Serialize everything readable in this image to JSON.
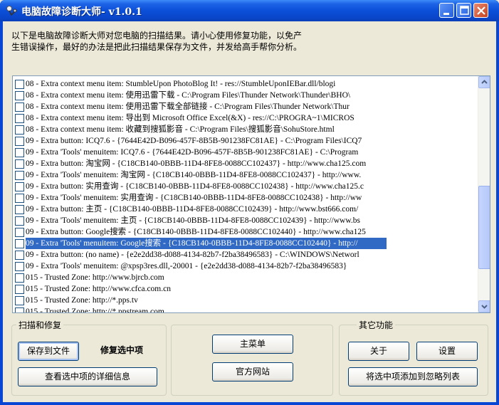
{
  "window": {
    "title": "电脑故障诊断大师- v1.0.1",
    "buttons": [
      "minimize",
      "maximize",
      "close"
    ]
  },
  "intro": {
    "line1": "以下是电脑故障诊断大师对您电脑的扫描结果。请小心使用修复功能，以免产",
    "line2": "生错误操作，最好的办法是把此扫描结果保存为文件，并发给高手帮你分析。"
  },
  "results": {
    "selected_index": 14,
    "items": [
      "08 - Extra context menu item: StumbleUpon PhotoBlog It! - res://StumbleUponIEBar.dll/blogi",
      "08 - Extra context menu item: 使用迅雷下载 - C:\\Program Files\\Thunder Network\\Thunder\\BHO\\",
      "08 - Extra context menu item: 使用迅雷下载全部链接 - C:\\Program Files\\Thunder Network\\Thur",
      "08 - Extra context menu item: 导出到 Microsoft Office Excel(&X) - res://C:\\PROGRA~1\\MICROS",
      "08 - Extra context menu item: 收藏到搜狐影音 - C:\\Program Files\\搜狐影音\\SohuStore.html",
      "09 - Extra button: ICQ7.6 - {7644E42D-B096-457F-8B5B-901238FC81AE} - C:\\Program Files\\ICQ7",
      "09 - Extra 'Tools' menuitem: ICQ7.6 - {7644E42D-B096-457F-8B5B-901238FC81AE} - C:\\Program",
      "09 - Extra button: 淘宝网 - {C18CB140-0BBB-11D4-8FE8-0088CC102437} - http://www.cha125.com",
      "09 - Extra 'Tools' menuitem: 淘宝网 - {C18CB140-0BBB-11D4-8FE8-0088CC102437} - http://www.",
      "09 - Extra button: 实用查询 - {C18CB140-0BBB-11D4-8FE8-0088CC102438} - http://www.cha125.c",
      "09 - Extra 'Tools' menuitem: 实用查询 - {C18CB140-0BBB-11D4-8FE8-0088CC102438} - http://ww",
      "09 - Extra button: 主页 - {C18CB140-0BBB-11D4-8FE8-0088CC102439} - http://www.bst666.com/",
      "09 - Extra 'Tools' menuitem: 主页 - {C18CB140-0BBB-11D4-8FE8-0088CC102439} - http://www.bs",
      "09 - Extra button: Google搜索 - {C18CB140-0BBB-11D4-8FE8-0088CC102440} - http://www.cha125",
      "09 - Extra 'Tools' menuitem: Google搜索 - {C18CB140-0BBB-11D4-8FE8-0088CC102440} - http://",
      "09 - Extra button: (no name) - {e2e2dd38-d088-4134-82b7-f2ba38496583} - C:\\WINDOWS\\Networl",
      "09 - Extra 'Tools' menuitem: @xpsp3res.dll,-20001 - {e2e2dd38-d088-4134-82b7-f2ba38496583}",
      "015 - Trusted Zone: http://www.bjrcb.com",
      "015 - Trusted Zone: http://www.cfca.com.cn",
      "015 - Trusted Zone: http://*.pps.tv",
      "015 - Trusted Zone: http://*.ppstream.com"
    ]
  },
  "groups": {
    "scan": {
      "label": "扫描和修复",
      "save_label": "保存到文件",
      "fix_label": "修复选中项",
      "details_label": "查看选中项的详细信息"
    },
    "middle": {
      "main_menu_label": "主菜单",
      "website_label": "官方网站"
    },
    "other": {
      "label": "其它功能",
      "about_label": "关于",
      "settings_label": "设置",
      "ignore_label": "将选中项添加到忽略列表"
    }
  },
  "colors": {
    "titlebar": "#0a4fd8",
    "selection": "#316ac5",
    "face": "#ece9d8"
  }
}
